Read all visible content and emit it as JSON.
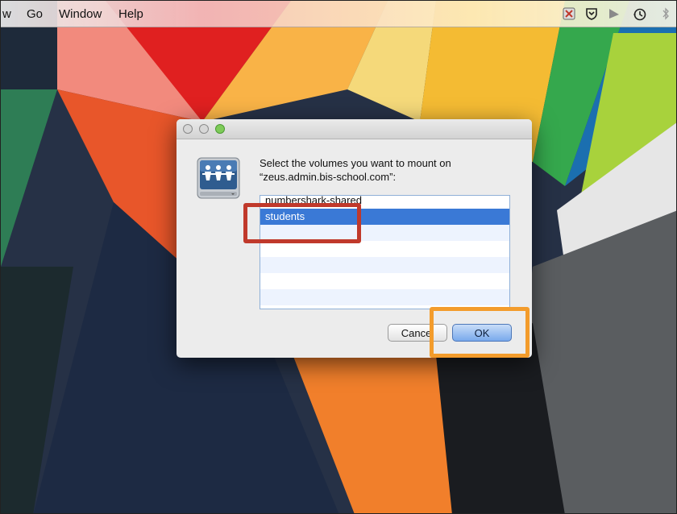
{
  "menubar": {
    "items": [
      "w",
      "Go",
      "Window",
      "Help"
    ]
  },
  "dialog": {
    "message_line1": "Select the volumes you want to mount on",
    "message_line2": "“zeus.admin.bis-school.com”:",
    "volumes": [
      "numbershark-shared",
      "students",
      "",
      "",
      "",
      "",
      ""
    ],
    "selected_index": 1,
    "cancel_label": "Cancel",
    "ok_label": "OK"
  },
  "colors": {
    "selection": "#3a79d6",
    "annotation_red": "#c0392b",
    "annotation_orange": "#f39c2c"
  },
  "icons": {
    "tray": [
      "close-x-icon",
      "shield-icon",
      "sail-icon",
      "time-machine-icon",
      "bluetooth-icon"
    ],
    "dialog": "network-disk-icon"
  }
}
